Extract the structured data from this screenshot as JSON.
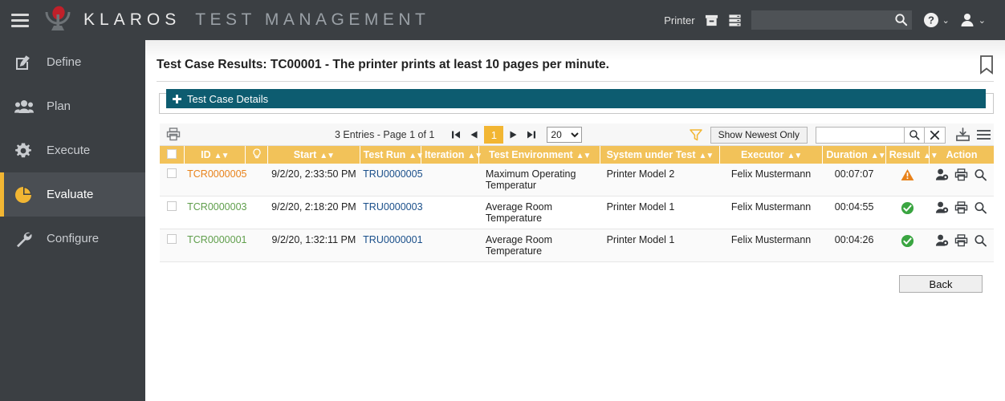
{
  "header": {
    "brand_primary": "KLAROS",
    "brand_secondary": "TEST MANAGEMENT",
    "menu_icon": "hamburger-menu-icon",
    "logo_icon": "klaros-logo-icon",
    "project_label": "Printer",
    "archive_icon": "archive-box-icon",
    "server_icon": "server-rack-icon",
    "search_value": "",
    "search_placeholder": "",
    "search_icon": "search-icon",
    "help_icon": "help-circle-icon",
    "user_icon": "user-avatar-icon",
    "caret_glyph": "⌄",
    "bg_color": "#3b3f43"
  },
  "sidebar": {
    "active": "Evaluate",
    "accent_color": "#f2b633",
    "items": [
      {
        "label": "Define",
        "icon": "pencil-square-icon",
        "active": false
      },
      {
        "label": "Plan",
        "icon": "users-group-icon",
        "active": false
      },
      {
        "label": "Execute",
        "icon": "gear-icon",
        "active": false
      },
      {
        "label": "Evaluate",
        "icon": "pie-chart-icon",
        "active": true
      },
      {
        "label": "Configure",
        "icon": "wrench-icon",
        "active": false
      }
    ]
  },
  "page": {
    "title": "Test Case Results: TC00001 - The printer prints at least 10 pages per minute.",
    "bookmark_icon": "bookmark-icon"
  },
  "details_panel": {
    "label": "Test Case Details",
    "expand_icon": "plus-icon",
    "bg_color": "#0d5c70"
  },
  "toolbar": {
    "print_icon": "printer-icon",
    "entries_label": "3 Entries - Page 1 of 1",
    "first_icon": "first-page-icon",
    "prev_icon": "previous-page-icon",
    "current_page": "1",
    "next_icon": "next-page-icon",
    "last_icon": "last-page-icon",
    "page_size_value": "20",
    "page_size_options": [
      "20"
    ],
    "filter_icon": "funnel-filter-icon",
    "show_newest_label": "Show Newest Only",
    "search_value": "",
    "search_placeholder": "",
    "search_icon": "search-icon",
    "clear_icon": "clear-x-icon",
    "export_icon": "export-download-icon",
    "menu_icon": "list-menu-icon"
  },
  "table": {
    "header_color": "#f2c259",
    "columns": [
      {
        "label": "",
        "name": "select-all",
        "sortable": false
      },
      {
        "label": "ID",
        "name": "id",
        "sortable": true
      },
      {
        "label": "",
        "name": "bulb",
        "sortable": false,
        "icon": "lightbulb-icon"
      },
      {
        "label": "Start",
        "name": "start",
        "sortable": true
      },
      {
        "label": "Test Run",
        "name": "test-run",
        "sortable": true
      },
      {
        "label": "Iteration",
        "name": "iteration",
        "sortable": true
      },
      {
        "label": "Test Environment",
        "name": "test-environment",
        "sortable": true
      },
      {
        "label": "System under Test",
        "name": "system-under-test",
        "sortable": true
      },
      {
        "label": "Executor",
        "name": "executor",
        "sortable": true
      },
      {
        "label": "Duration",
        "name": "duration",
        "sortable": true
      },
      {
        "label": "Result",
        "name": "result",
        "sortable": true
      },
      {
        "label": "Action",
        "name": "action",
        "sortable": false
      }
    ],
    "rows": [
      {
        "id": "TCR0000005",
        "id_status": "warn",
        "start": "9/2/20, 2:33:50 PM",
        "test_run": "TRU0000005",
        "iteration": "",
        "test_environment": "Maximum Operating Temperatur",
        "system_under_test": "Printer Model 2",
        "executor": "Felix Mustermann",
        "duration": "00:07:07",
        "result": "warning",
        "result_icon": "warning-triangle-icon",
        "actions": [
          "assign-user-icon",
          "print-icon",
          "search-icon"
        ]
      },
      {
        "id": "TCR0000003",
        "id_status": "ok",
        "start": "9/2/20, 2:18:20 PM",
        "test_run": "TRU0000003",
        "iteration": "",
        "test_environment": "Average Room Temperature",
        "system_under_test": "Printer Model 1",
        "executor": "Felix Mustermann",
        "duration": "00:04:55",
        "result": "success",
        "result_icon": "success-check-icon",
        "actions": [
          "assign-user-icon",
          "print-icon",
          "search-icon"
        ]
      },
      {
        "id": "TCR0000001",
        "id_status": "ok",
        "start": "9/2/20, 1:32:11 PM",
        "test_run": "TRU0000001",
        "iteration": "",
        "test_environment": "Average Room Temperature",
        "system_under_test": "Printer Model 1",
        "executor": "Felix Mustermann",
        "duration": "00:04:26",
        "result": "success",
        "result_icon": "success-check-icon",
        "actions": [
          "assign-user-icon",
          "print-icon",
          "search-icon"
        ]
      }
    ]
  },
  "footer": {
    "back_label": "Back"
  },
  "colors": {
    "accent_yellow": "#f2b633",
    "teal": "#0d5c70",
    "success_green": "#3aa541",
    "warn_orange": "#e8821a",
    "dark_chrome": "#3b3f43"
  }
}
